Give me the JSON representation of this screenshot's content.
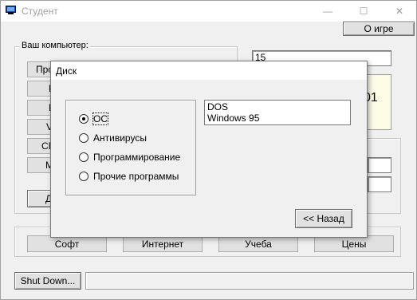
{
  "window": {
    "title": "Студент",
    "icon": "computer-icon"
  },
  "title_controls": {
    "min_glyph": "—",
    "max_glyph": "☐",
    "close_glyph": "✕"
  },
  "about_button": "О игре",
  "computer_group": {
    "caption": "Ваш компьютер:",
    "buttons": [
      "Про",
      "Н",
      "R",
      "V",
      "CD",
      "M",
      "Д"
    ]
  },
  "right_panel": {
    "top_field": "15",
    "yellow_text": "01"
  },
  "nav_buttons": [
    "Софт",
    "Интернет",
    "Учеба",
    "Цены"
  ],
  "shutdown_button": "Shut Down...",
  "dialog": {
    "title": "Диск",
    "radio_options": [
      {
        "label": "ОС",
        "selected": true
      },
      {
        "label": "Антивирусы",
        "selected": false
      },
      {
        "label": "Программирование",
        "selected": false
      },
      {
        "label": "Прочие программы",
        "selected": false
      }
    ],
    "list_items": [
      "DOS",
      "Windows 95"
    ],
    "back_button": "<< Назад"
  }
}
